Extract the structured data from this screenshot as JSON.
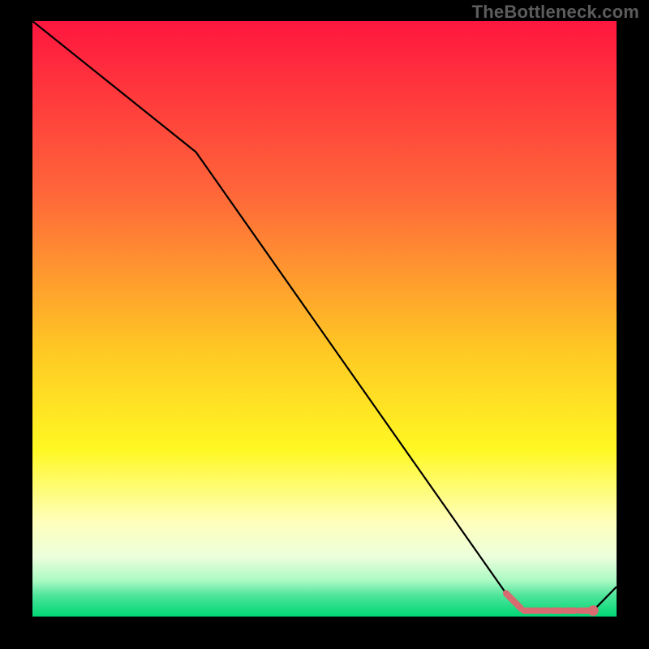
{
  "watermark": "TheBottleneck.com",
  "chart_data": {
    "type": "line",
    "title": "",
    "xlabel": "",
    "ylabel": "",
    "xlim": [
      0,
      100
    ],
    "ylim": [
      0,
      100
    ],
    "grid": false,
    "legend": false,
    "gradient_stops": [
      {
        "offset": 0.0,
        "color": "#ff163f"
      },
      {
        "offset": 0.3,
        "color": "#ff6a39"
      },
      {
        "offset": 0.55,
        "color": "#ffc724"
      },
      {
        "offset": 0.72,
        "color": "#fff823"
      },
      {
        "offset": 0.84,
        "color": "#ffffbb"
      },
      {
        "offset": 0.9,
        "color": "#ecffdc"
      },
      {
        "offset": 0.94,
        "color": "#aaf9c3"
      },
      {
        "offset": 0.965,
        "color": "#4de49a"
      },
      {
        "offset": 1.0,
        "color": "#00d774"
      }
    ],
    "series": [
      {
        "name": "bottleneck-curve",
        "color": "#000000",
        "x": [
          0,
          28,
          81,
          84,
          90,
          94,
          96,
          100
        ],
        "values": [
          100,
          78,
          4,
          1,
          1,
          1,
          1,
          5
        ]
      }
    ],
    "markers": {
      "name": "highlight-segment",
      "color": "#d76b6f",
      "style": "dash-dot-thick",
      "x": [
        81,
        84,
        85.5,
        87,
        89,
        91,
        93.5,
        96
      ],
      "values": [
        4,
        1,
        1,
        1,
        1,
        1,
        1,
        1
      ],
      "end_dot": {
        "x": 96,
        "y": 1
      }
    }
  }
}
